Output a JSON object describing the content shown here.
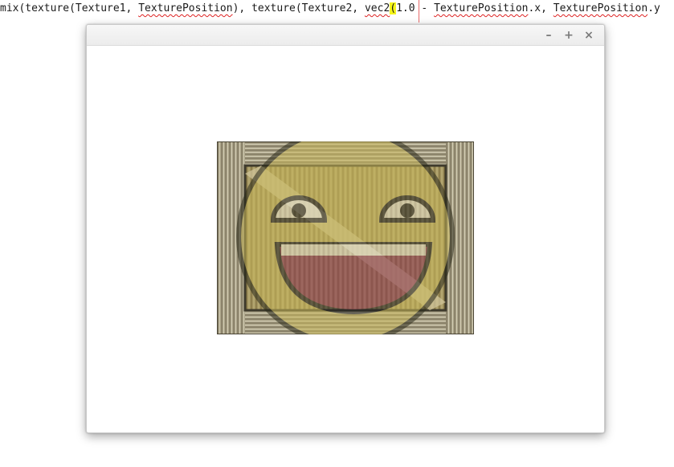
{
  "editor": {
    "code_parts": [
      "mix(texture(Texture1, ",
      "TexturePosition",
      "), texture(Texture2, ",
      "vec2",
      "(",
      "1.0 - ",
      "TexturePosition",
      ".x, ",
      "TexturePosition",
      ".y"
    ]
  },
  "window": {
    "controls": {
      "minimize": "–",
      "maximize": "+",
      "close": "×"
    }
  },
  "colors": {
    "squiggle": "#dd2222",
    "paren_highlight": "#f5f51a",
    "wood_light": "#b7ae86",
    "wood_dark": "#5c5440",
    "face_yellow": "#c9b85a"
  },
  "icons": [
    "minimize-icon",
    "maximize-icon",
    "close-icon"
  ]
}
